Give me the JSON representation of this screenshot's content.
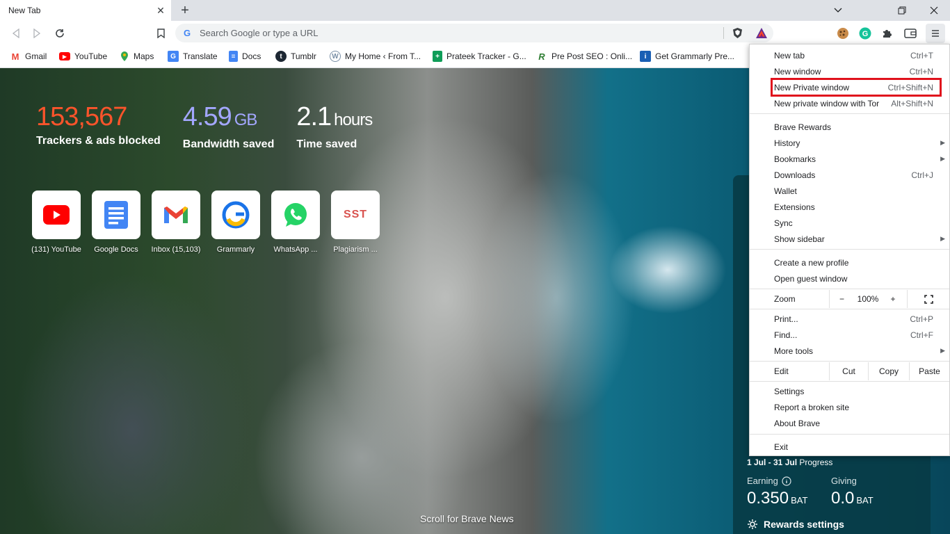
{
  "tab": {
    "title": "New Tab",
    "close": "✕",
    "new": "+"
  },
  "window_controls": {
    "minimize": "⌄",
    "restore": "❐",
    "close": "✕"
  },
  "omnibox": {
    "placeholder": "Search Google or type a URL",
    "g": "G"
  },
  "bookmarks": [
    {
      "label": "Gmail",
      "icon": "gmail-icon",
      "color": "#ea4335",
      "glyph": "M"
    },
    {
      "label": "YouTube",
      "icon": "youtube-icon",
      "color": "#ff0000",
      "glyph": "▶"
    },
    {
      "label": "Maps",
      "icon": "maps-icon",
      "color": "#34a853",
      "glyph": "●"
    },
    {
      "label": "Translate",
      "icon": "translate-icon",
      "color": "#4285f4",
      "glyph": "G"
    },
    {
      "label": "Docs",
      "icon": "docs-icon",
      "color": "#4285f4",
      "glyph": "≡"
    },
    {
      "label": "Tumblr",
      "icon": "tumblr-icon",
      "color": "#1d2733",
      "glyph": "t"
    },
    {
      "label": "My Home ‹ From T...",
      "icon": "wordpress-icon",
      "color": "#7a8fa6",
      "glyph": "W"
    },
    {
      "label": "Prateek Tracker - G...",
      "icon": "sheets-icon",
      "color": "#0f9d58",
      "glyph": "+"
    },
    {
      "label": "Pre Post SEO : Onli...",
      "icon": "prepostseo-icon",
      "color": "#2e7d32",
      "glyph": "R"
    },
    {
      "label": "Get Grammarly Pre...",
      "icon": "grammarly-page-icon",
      "color": "#1a5fb4",
      "glyph": "i"
    }
  ],
  "stats": [
    {
      "value": "153,567",
      "unit": "",
      "label": "Trackers & ads blocked",
      "color": "#fb542b"
    },
    {
      "value": "4.59",
      "unit": "GB",
      "label": "Bandwidth saved",
      "color": "#a3a7ff"
    },
    {
      "value": "2.1",
      "unit": "hours",
      "label": "Time saved",
      "color": "#ffffff"
    }
  ],
  "tiles": [
    {
      "label": "(131) YouTube",
      "icon": "youtube-icon"
    },
    {
      "label": "Google Docs",
      "icon": "docs-icon"
    },
    {
      "label": "Inbox (15,103)",
      "icon": "gmail-icon"
    },
    {
      "label": "Grammarly",
      "icon": "grammarly-icon"
    },
    {
      "label": "WhatsApp ...",
      "icon": "whatsapp-icon"
    },
    {
      "label": "Plagiarism ...",
      "icon": "sst-icon",
      "logo": "SST"
    }
  ],
  "scroll_news": "Scroll for Brave News",
  "rewards": {
    "period": "1 Jul - 31 Jul",
    "progress": "Progress",
    "earning_label": "Earning",
    "earning_value": "0.350",
    "giving_label": "Giving",
    "giving_value": "0.0",
    "unit": "BAT",
    "settings": "Rewards settings"
  },
  "menu": {
    "new_tab": "New tab",
    "new_tab_sc": "Ctrl+T",
    "new_window": "New window",
    "new_window_sc": "Ctrl+N",
    "new_private": "New Private window",
    "new_private_sc": "Ctrl+Shift+N",
    "new_tor": "New private window with Tor",
    "new_tor_sc": "Alt+Shift+N",
    "brave_rewards": "Brave Rewards",
    "history": "History",
    "bookmarks": "Bookmarks",
    "downloads": "Downloads",
    "downloads_sc": "Ctrl+J",
    "wallet": "Wallet",
    "extensions": "Extensions",
    "sync": "Sync",
    "show_sidebar": "Show sidebar",
    "create_profile": "Create a new profile",
    "guest_window": "Open guest window",
    "zoom": "Zoom",
    "zoom_minus": "−",
    "zoom_value": "100%",
    "zoom_plus": "+",
    "print": "Print...",
    "print_sc": "Ctrl+P",
    "find": "Find...",
    "find_sc": "Ctrl+F",
    "more_tools": "More tools",
    "edit": "Edit",
    "cut": "Cut",
    "copy": "Copy",
    "paste": "Paste",
    "settings": "Settings",
    "report": "Report a broken site",
    "about": "About Brave",
    "exit": "Exit"
  },
  "colors": {
    "highlight": "#e0111c",
    "brave_orange": "#fb542b"
  }
}
